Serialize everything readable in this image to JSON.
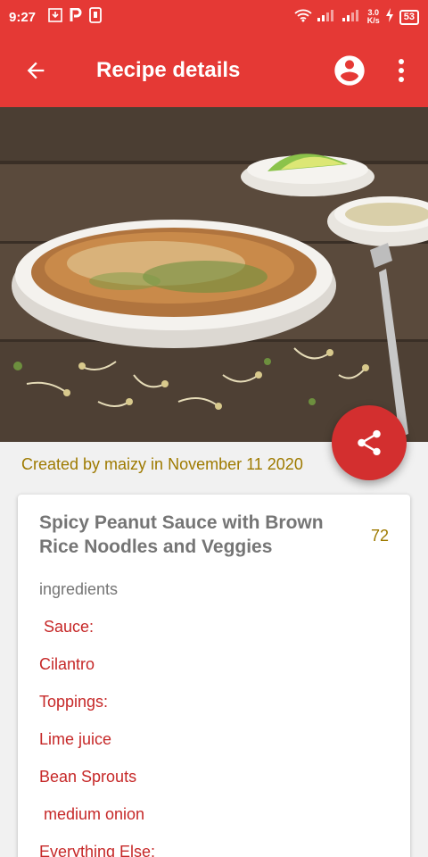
{
  "status": {
    "time": "9:27",
    "netspeed_top": "3.0",
    "netspeed_bottom": "K/s",
    "battery": "53"
  },
  "appbar": {
    "title": "Recipe details"
  },
  "recipe": {
    "created": "Created by maizy in November 11 2020",
    "title": "Spicy Peanut Sauce with Brown Rice Noodles and Veggies",
    "count": "72",
    "ingredients_label": "ingredients",
    "ingredients": [
      " Sauce:",
      "Cilantro",
      "Toppings:",
      "Lime juice",
      "Bean Sprouts",
      " medium onion",
      "Everything Else:"
    ]
  },
  "colors": {
    "primary": "#e53935",
    "fab": "#d32f2f",
    "accent_text": "#9e7a00",
    "ingredient_text": "#c62828"
  }
}
